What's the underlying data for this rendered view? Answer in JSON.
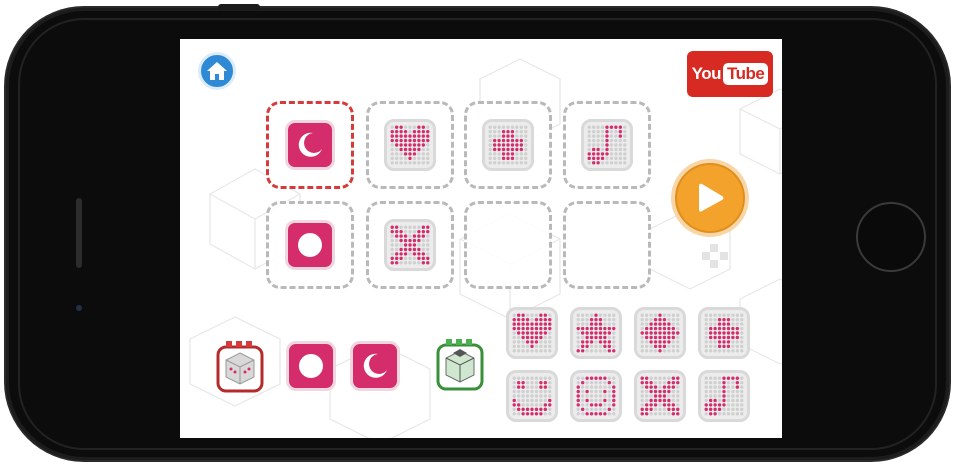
{
  "app": {
    "youtube_label_you": "You",
    "youtube_label_tube": "Tube"
  },
  "icons": {
    "home": "house",
    "youtube": "youtube-logo",
    "play": "play-triangle",
    "cube_red": "sensor-cube-red",
    "cube_green": "sensor-cube-green"
  },
  "colors": {
    "accent_pink": "#d52c6b",
    "home_blue": "#2f8ad6",
    "play_orange": "#f3a22c",
    "youtube_red": "#d62a23",
    "active_slot": "#d73a3a"
  },
  "sequence_slots": [
    {
      "pattern": "moon",
      "style": "solid",
      "active": true
    },
    {
      "pattern": "heart",
      "style": "grid",
      "active": false
    },
    {
      "pattern": "plus",
      "style": "grid",
      "active": false
    },
    {
      "pattern": "note",
      "style": "grid",
      "active": false
    },
    {
      "pattern": "circle",
      "style": "solid",
      "active": false
    },
    {
      "pattern": "cross",
      "style": "grid",
      "active": false
    },
    {
      "pattern": "empty",
      "style": "empty",
      "active": false
    },
    {
      "pattern": "empty",
      "style": "empty",
      "active": false
    }
  ],
  "event_row": [
    {
      "pattern": "circle",
      "style": "solid"
    },
    {
      "pattern": "moon",
      "style": "solid"
    }
  ],
  "palette": [
    "heart",
    "star",
    "diamond",
    "plus",
    "smile",
    "smile-face",
    "cross",
    "note"
  ]
}
